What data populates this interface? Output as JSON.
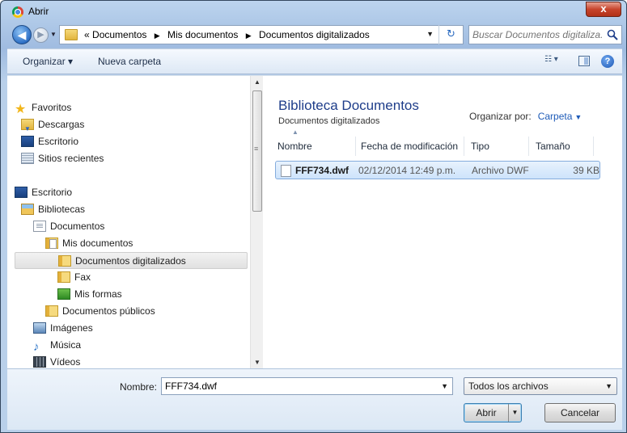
{
  "window": {
    "title": "Abrir",
    "close_label": "x"
  },
  "navigation": {
    "back_glyph": "◀",
    "forward_glyph": "▶",
    "breadcrumb": {
      "prefix": "«",
      "parts": [
        "Documentos",
        "Mis documentos",
        "Documentos digitalizados"
      ]
    },
    "refresh_glyph": "↻",
    "search_placeholder": "Buscar Documentos digitaliza..."
  },
  "toolbar": {
    "organize_label": "Organizar ▾",
    "new_folder_label": "Nueva carpeta",
    "help_label": "?"
  },
  "tree": [
    {
      "label": "Favoritos",
      "icon": "star-icon"
    },
    {
      "label": "Descargas",
      "icon": "downloads-folder-icon"
    },
    {
      "label": "Escritorio",
      "icon": "desktop-icon"
    },
    {
      "label": "Sitios recientes",
      "icon": "recent-places-icon"
    },
    {
      "label": "Escritorio",
      "icon": "desktop-icon"
    },
    {
      "label": "Bibliotecas",
      "icon": "libraries-icon"
    },
    {
      "label": "Documentos",
      "icon": "document-library-icon"
    },
    {
      "label": "Mis documentos",
      "icon": "folder-documents-icon"
    },
    {
      "label": "Documentos digitalizados",
      "icon": "folder-icon",
      "selected": true
    },
    {
      "label": "Fax",
      "icon": "folder-icon"
    },
    {
      "label": "Mis formas",
      "icon": "forms-folder-icon"
    },
    {
      "label": "Documentos públicos",
      "icon": "folder-icon"
    },
    {
      "label": "Imágenes",
      "icon": "pictures-library-icon"
    },
    {
      "label": "Música",
      "icon": "music-library-icon"
    },
    {
      "label": "Vídeos",
      "icon": "videos-library-icon"
    }
  ],
  "library": {
    "title": "Biblioteca Documentos",
    "subtitle": "Documentos digitalizados",
    "arrange_label": "Organizar por:",
    "arrange_value": "Carpeta"
  },
  "columns": [
    "Nombre",
    "Fecha de modificación",
    "Tipo",
    "Tamaño"
  ],
  "files": [
    {
      "name": "FFF734.dwf",
      "date": "02/12/2014 12:49 p.m.",
      "type": "Archivo DWF",
      "size": "39 KB"
    }
  ],
  "footer": {
    "filename_label": "Nombre:",
    "filename_value": "FFF734.dwf",
    "filter_value": "Todos los archivos",
    "open_label": "Abrir",
    "cancel_label": "Cancelar"
  },
  "colors": {
    "accent_title": "#1e3d8a",
    "selection_fill": "#cde3fb",
    "close_button": "#c7442c"
  }
}
